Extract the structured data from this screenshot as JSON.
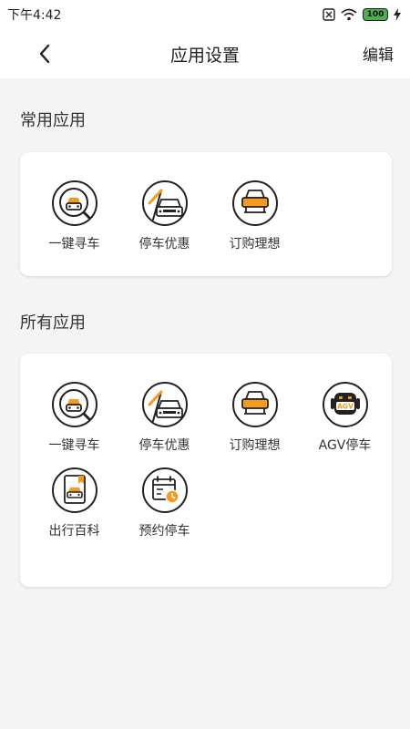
{
  "status_bar": {
    "time": "下午4:42",
    "battery": "100"
  },
  "nav": {
    "title": "应用设置",
    "edit_label": "编辑"
  },
  "common": {
    "title": "常用应用",
    "apps": [
      {
        "label": "一键寻车",
        "icon": "car-search-icon"
      },
      {
        "label": "停车优惠",
        "icon": "parking-discount-icon"
      },
      {
        "label": "订购理想",
        "icon": "order-car-icon"
      }
    ]
  },
  "all": {
    "title": "所有应用",
    "apps": [
      {
        "label": "一键寻车",
        "icon": "car-search-icon"
      },
      {
        "label": "停车优惠",
        "icon": "parking-discount-icon"
      },
      {
        "label": "订购理想",
        "icon": "order-car-icon"
      },
      {
        "label": "AGV停车",
        "icon": "agv-robot-icon"
      },
      {
        "label": "出行百科",
        "icon": "travel-book-icon"
      },
      {
        "label": "预约停车",
        "icon": "calendar-clock-icon"
      }
    ]
  },
  "colors": {
    "accent": "#f39a1f",
    "outline": "#222222",
    "background": "#f4f4f4"
  }
}
